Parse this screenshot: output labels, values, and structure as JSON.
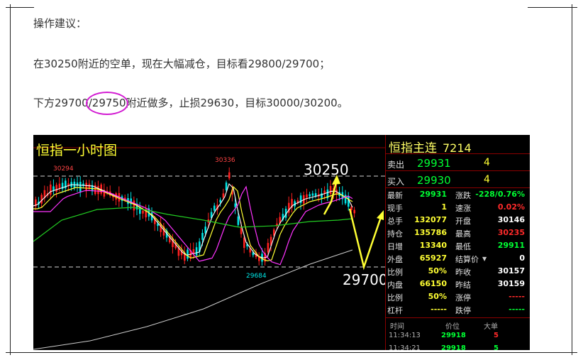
{
  "article": {
    "line1": "操作建议：",
    "line2": "在30250附近的空单，现在大幅减仓，目标看29800/29700；",
    "line3_pre": "下方29700/",
    "line3_hl": "29750",
    "line3_post": "附近做多，止损29630，目标30000/30200。"
  },
  "chart": {
    "title": "恒指一小时图",
    "label_high_left": "30294",
    "label_high_mid": "30336",
    "label_low": "29684",
    "label_target_up": "30250",
    "label_target_down": "29700",
    "colors": {
      "up": "#00e5e5",
      "down": "#ff2020",
      "ma_white": "#ffffff",
      "ma_yellow": "#ffff33",
      "ma_magenta": "#ff33ff",
      "ma_green": "#22cc22",
      "ma_gray": "#cccccc",
      "arrow": "#ffff33"
    }
  },
  "quote": {
    "name": "恒指主连",
    "code": "7214",
    "sell_label": "卖出",
    "sell_price": "29931",
    "sell_vol": "4",
    "buy_label": "买入",
    "buy_price": "29930",
    "buy_vol": "4",
    "rows": [
      {
        "l1": "最新",
        "v1": "29931",
        "c1": "g",
        "l2": "涨跌",
        "v2": "-228/0.76%",
        "c2": "g"
      },
      {
        "l1": "现手",
        "v1": "1",
        "c1": "y",
        "l2": "速涨",
        "v2": "0.02%",
        "c2": "r"
      },
      {
        "l1": "总手",
        "v1": "132077",
        "c1": "y",
        "l2": "开盘",
        "v2": "30146",
        "c2": "w"
      },
      {
        "l1": "持仓",
        "v1": "135786",
        "c1": "y",
        "l2": "最高",
        "v2": "30235",
        "c2": "r"
      },
      {
        "l1": "日增",
        "v1": "13340",
        "c1": "y",
        "l2": "最低",
        "v2": "29911",
        "c2": "g"
      },
      {
        "l1": "外盘",
        "v1": "65927",
        "c1": "y",
        "l2": "结算价",
        "v2": "0",
        "c2": "w"
      },
      {
        "l1": "比例",
        "v1": "50%",
        "c1": "y",
        "l2": "昨收",
        "v2": "30157",
        "c2": "w"
      },
      {
        "l1": "内盘",
        "v1": "66150",
        "c1": "y",
        "l2": "昨结",
        "v2": "30159",
        "c2": "w"
      },
      {
        "l1": "比例",
        "v1": "50%",
        "c1": "y",
        "l2": "涨停",
        "v2": "-----",
        "c2": "r"
      },
      {
        "l1": "杠杆",
        "v1": "-----",
        "c1": "y",
        "l2": "跌停",
        "v2": "-----",
        "c2": "g"
      }
    ],
    "ticks_header": {
      "time": "时间",
      "price": "价位",
      "vol": "大单"
    },
    "ticks": [
      {
        "time": "11:34:13",
        "price": "29918",
        "vol": "5"
      },
      {
        "time": "11:34:21",
        "price": "29918",
        "vol": "5"
      }
    ]
  }
}
